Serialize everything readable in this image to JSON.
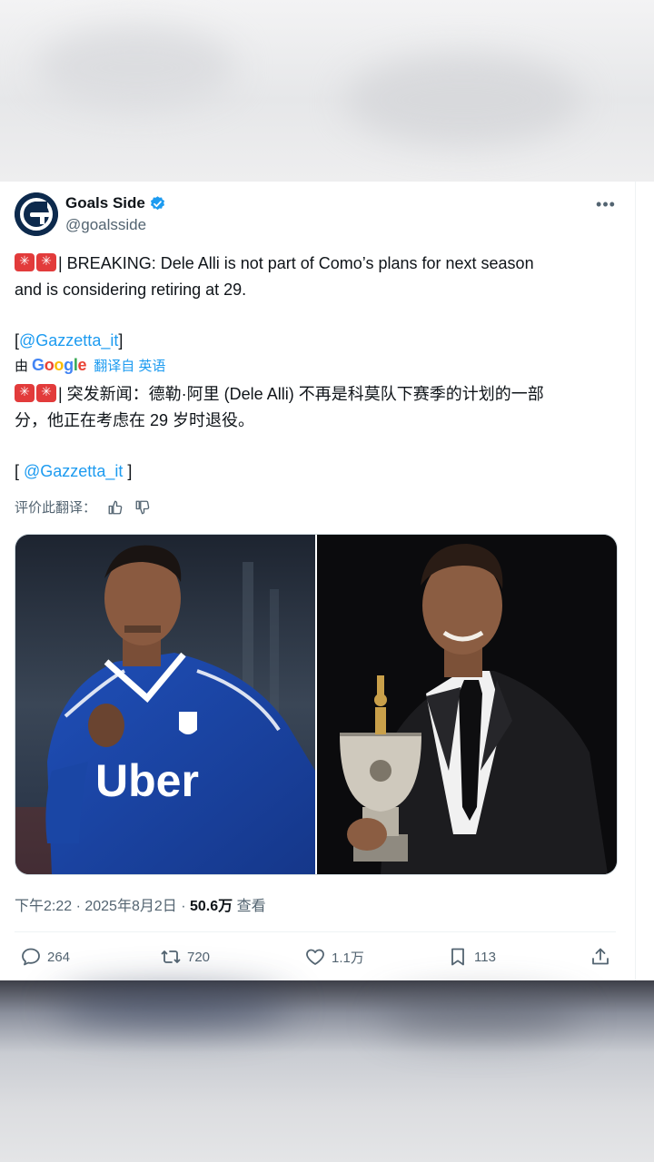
{
  "tweet": {
    "author_name": "Goals Side",
    "author_handle": "@goalsside",
    "original_text_1": "| BREAKING: Dele Alli is not part of Como’s plans for next season",
    "original_text_2": "and is considering retiring at 29.",
    "source_open": "[",
    "source_link": "@Gazzetta_it",
    "source_close": "]",
    "translated_by": "由",
    "google": [
      "G",
      "o",
      "o",
      "g",
      "l",
      "e"
    ],
    "translated_from": "翻译自 英语",
    "translated_text_1": "| 突发新闻：德勒·阿里 (Dele Alli) 不再是科莫队下赛季的计划的一部",
    "translated_text_2": "分，他正在考虑在 29 岁时退役。",
    "translated_source_open": "[ ",
    "translated_source_link": "@Gazzetta_it",
    "translated_source_close": " ]",
    "rate_translation": "评价此翻译：",
    "time": "下午2:22 · 2025年8月2日 · ",
    "views_count": "50.6万",
    "views_label": " 查看"
  },
  "actions": {
    "replies": "264",
    "retweets": "720",
    "likes": "1.1万",
    "bookmarks": "113"
  },
  "icons": {
    "verified": "verified-badge-icon",
    "more": "more-icon",
    "reply": "reply-icon",
    "retweet": "retweet-icon",
    "like": "heart-icon",
    "bookmark": "bookmark-icon",
    "share": "share-icon",
    "thumbs_up": "thumbs-up-icon",
    "thumbs_down": "thumbs-down-icon"
  },
  "colors": {
    "link": "#1d9bf0",
    "secondary_text": "#536471",
    "primary_text": "#0f1419"
  },
  "media": {
    "photo_left": "Player in blue Como jersey with Uber sponsor",
    "photo_right": "Player in black suit holding award trophy"
  }
}
